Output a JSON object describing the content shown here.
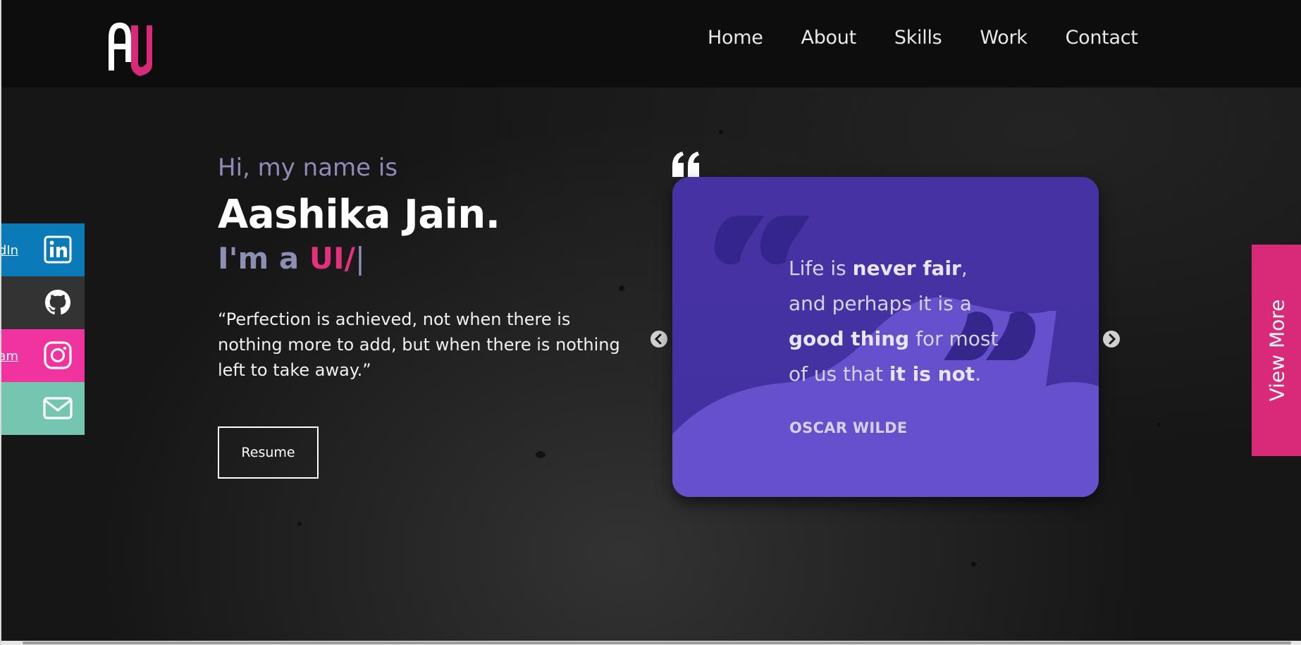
{
  "brand": {
    "logo_letters": "AJ"
  },
  "nav": {
    "links": [
      {
        "label": "Home"
      },
      {
        "label": "About"
      },
      {
        "label": "Skills"
      },
      {
        "label": "Work"
      },
      {
        "label": "Contact"
      }
    ]
  },
  "hero": {
    "greeting": "Hi, my name is",
    "name": "Aashika Jain.",
    "role_prefix": "I'm a ",
    "role_typed": "UI/",
    "role_cursor": "|",
    "quote": "“Perfection is achieved, not when there is nothing more to add, but when there is nothing left to take away.”",
    "resume_label": "Resume"
  },
  "social": {
    "items": [
      {
        "name": "linkedin-icon",
        "label": "LinkedIn",
        "color": "#0a7ab8"
      },
      {
        "name": "github-icon",
        "label": "",
        "color": "#333333"
      },
      {
        "name": "instagram-icon",
        "label": "Instagram",
        "color": "#f0339e"
      },
      {
        "name": "mail-icon",
        "label": "",
        "color": "#74c6b0"
      }
    ]
  },
  "carousel": {
    "slide": {
      "line1_a": "Life is ",
      "line1_b": "never fair",
      "line1_c": ",",
      "line2": "and perhaps it is a",
      "line3_a": "good thing",
      "line3_b": " for most",
      "line4_a": "of us that ",
      "line4_b": "it is not",
      "line4_c": ".",
      "author": "OSCAR WILDE"
    }
  },
  "view_more": {
    "label": "View More"
  },
  "colors": {
    "accent": "#e5317d",
    "muted": "#8e8bb8",
    "slide_bg": "#4b34a6"
  }
}
